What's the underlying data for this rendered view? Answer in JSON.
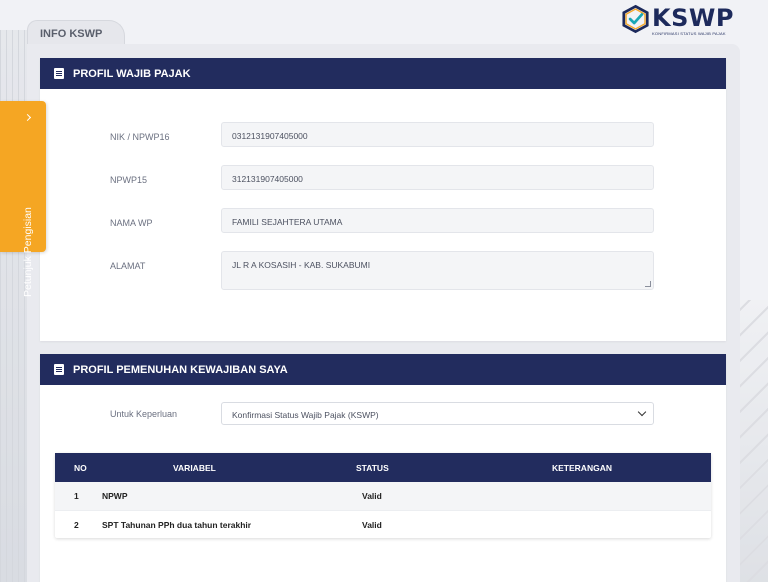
{
  "logo": {
    "title": "KSWP",
    "subtitle": "KONFIRMASI STATUS WAJIB PAJAK",
    "colors": {
      "navy": "#1d2a5c",
      "teal": "#18a7b5",
      "orange": "#f5a623"
    }
  },
  "tab": {
    "label": "INFO KSWP"
  },
  "side_panel": {
    "label": "Petunjuk Pengisian",
    "icon": "chevron-right-icon"
  },
  "profile": {
    "header": "PROFIL WAJIB PAJAK",
    "header_icon": "document-icon",
    "fields": [
      {
        "label": "NIK / NPWP16",
        "value": "0312131907405000"
      },
      {
        "label": "NPWP15",
        "value": "312131907405000"
      },
      {
        "label": "NAMA WP",
        "value": "FAMILI SEJAHTERA UTAMA"
      },
      {
        "label": "ALAMAT",
        "value": "JL R A KOSASIH - KAB. SUKABUMI"
      }
    ]
  },
  "compliance": {
    "header": "PROFIL PEMENUHAN KEWAJIBAN SAYA",
    "header_icon": "document-icon",
    "purpose_label": "Untuk Keperluan",
    "purpose_value": "Konfirmasi Status Wajib Pajak (KSWP)",
    "table": {
      "headers": [
        "NO",
        "VARIABEL",
        "STATUS",
        "KETERANGAN"
      ],
      "rows": [
        {
          "no": "1",
          "variabel": "NPWP",
          "status": "Valid",
          "keterangan": ""
        },
        {
          "no": "2",
          "variabel": "SPT Tahunan PPh dua tahun terakhir",
          "status": "Valid",
          "keterangan": ""
        }
      ]
    }
  },
  "colors": {
    "header_bg": "#222c5e",
    "page_bg": "#f1f2f6",
    "accent_tab": "#f5a623"
  }
}
